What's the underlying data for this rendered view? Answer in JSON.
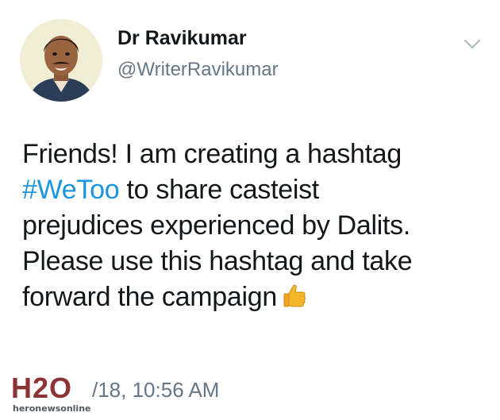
{
  "tweet": {
    "display_name": "Dr Ravikumar",
    "handle": "@WriterRavikumar",
    "avatar_icon": "profile-photo",
    "caret_icon": "chevron-down-icon",
    "text_lines": [
      {
        "text": "Friends! I am creating a hashtag"
      },
      {
        "hashtag": "#WeToo",
        "text": " to share casteist"
      },
      {
        "text": "prejudices experienced by Dalits."
      },
      {
        "text": "Please use this hashtag and take"
      },
      {
        "text": "forward the campaign"
      }
    ],
    "emoji_icon": "thumbs-up-icon",
    "timestamp": "/18, 10:56 AM"
  },
  "watermark": {
    "logo": "H2O",
    "text": "heronewsonline"
  },
  "colors": {
    "link": "#1b95e0",
    "secondary_text": "#657786",
    "primary_text": "#14171a"
  }
}
